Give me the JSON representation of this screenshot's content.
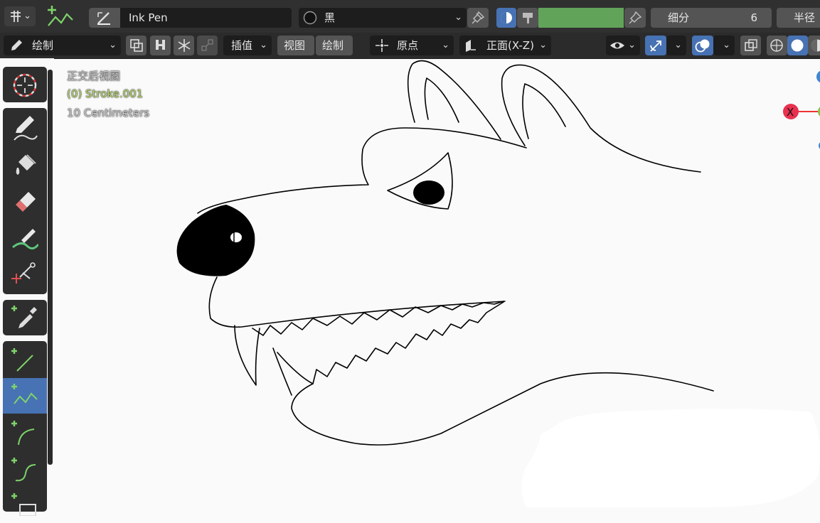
{
  "header": {
    "brush_name": "Ink Pen",
    "material_name": "黑",
    "subdivide_label": "细分",
    "subdivide_value": "6",
    "radius_label": "半径",
    "mode_label": "绘制",
    "interp_label": "插值",
    "view_label": "视图",
    "draw_label": "绘制",
    "origin_label": "原点",
    "plane_label": "正面(X-Z)",
    "color_accent": "#4772b3",
    "color_green": "#62a35a"
  },
  "viewport": {
    "view_name": "正交后视图",
    "object_name": "(0) Stroke.001",
    "scale_text": "10 Centimeters",
    "gizmo_x": "X"
  },
  "tools": [
    {
      "name": "cursor-tool",
      "icon": "crosshair-icon"
    },
    {
      "name": "draw-tool",
      "icon": "pencil-icon"
    },
    {
      "name": "fill-tool",
      "icon": "bucket-icon"
    },
    {
      "name": "erase-tool",
      "icon": "eraser-icon"
    },
    {
      "name": "tint-tool",
      "icon": "brush-icon"
    },
    {
      "name": "cutter-tool",
      "icon": "scissors-icon"
    },
    {
      "name": "eyedropper-tool",
      "icon": "eyedropper-icon"
    },
    {
      "name": "line-tool",
      "icon": "line-icon"
    },
    {
      "name": "polyline-tool",
      "icon": "polyline-icon"
    },
    {
      "name": "arc-tool",
      "icon": "arc-icon"
    },
    {
      "name": "curve-tool",
      "icon": "curve-icon"
    },
    {
      "name": "box-tool",
      "icon": "box-icon"
    }
  ]
}
